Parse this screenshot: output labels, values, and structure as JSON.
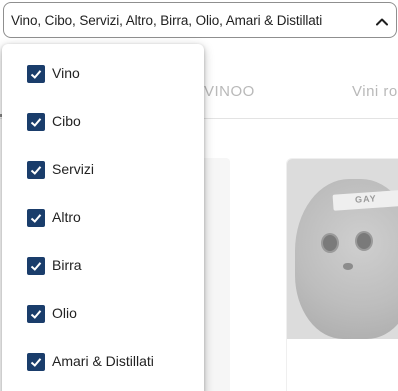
{
  "filter": {
    "selected_text": "Vino, Cibo, Servizi, Altro, Birra, Olio, Amari & Distillati",
    "expanded": true,
    "options": [
      {
        "label": "Vino",
        "checked": true
      },
      {
        "label": "Cibo",
        "checked": true
      },
      {
        "label": "Servizi",
        "checked": true
      },
      {
        "label": "Altro",
        "checked": true
      },
      {
        "label": "Birra",
        "checked": true
      },
      {
        "label": "Olio",
        "checked": true
      },
      {
        "label": "Amari & Distillati",
        "checked": true
      }
    ]
  },
  "background": {
    "tabs": [
      "VINOO",
      "Vini ro"
    ],
    "card_image_text": "GAY"
  },
  "colors": {
    "checkbox": "#1a3d6b",
    "select_border": "#8f8f8f",
    "tab_text": "#b9b9b9"
  },
  "icons": {
    "chevron": "chevron-up-icon",
    "check": "check-icon"
  }
}
